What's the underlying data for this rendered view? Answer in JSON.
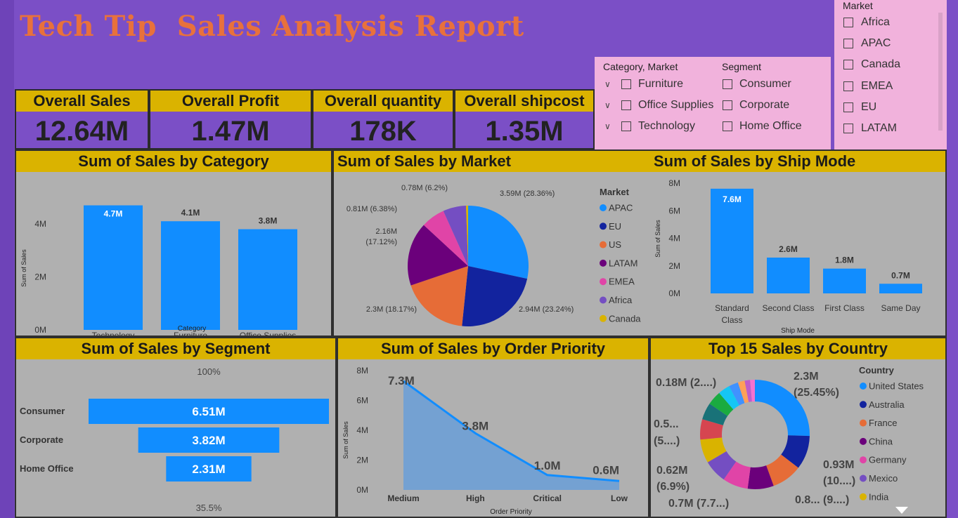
{
  "title": "Tech Tip  Sales Analysis Report",
  "kpis": [
    {
      "label": "Overall Sales",
      "value": "12.64M"
    },
    {
      "label": "Overall Profit",
      "value": "1.47M"
    },
    {
      "label": "Overall quantity",
      "value": "178K"
    },
    {
      "label": "Overall shipcost",
      "value": "1.35M"
    }
  ],
  "slicers": {
    "category_market_label": "Category, Market",
    "categories": [
      "Furniture",
      "Office Supplies",
      "Technology"
    ],
    "segment_label": "Segment",
    "segments": [
      "Consumer",
      "Corporate",
      "Home Office"
    ],
    "market_label": "Market",
    "markets": [
      "Africa",
      "APAC",
      "Canada",
      "EMEA",
      "EU",
      "LATAM"
    ]
  },
  "colors": {
    "accent": "#dab300",
    "bar": "#118dff",
    "panel": "#b0b0b0",
    "page": "#7b4fc6",
    "title": "#e8713c"
  },
  "chart_data": [
    {
      "title": "Sum of Sales by Category",
      "type": "bar",
      "categories": [
        "Technology",
        "Furniture",
        "Office Supplies"
      ],
      "values": [
        4.7,
        4.1,
        3.8
      ],
      "value_labels": [
        "4.7M",
        "4.1M",
        "3.8M"
      ],
      "xlabel": "Category",
      "ylabel": "Sum of Sales",
      "ticks": [
        "0M",
        "2M",
        "4M"
      ],
      "ylim": [
        0,
        4.9
      ]
    },
    {
      "title": "Sum of Sales by Market",
      "type": "pie",
      "legend_title": "Market",
      "series": [
        {
          "name": "APAC",
          "value": 3.59,
          "label": "3.59M (28.36%)",
          "color": "#118dff"
        },
        {
          "name": "EU",
          "value": 2.94,
          "label": "2.94M (23.24%)",
          "color": "#12239e"
        },
        {
          "name": "US",
          "value": 2.3,
          "label": "2.3M (18.17%)",
          "color": "#e66c37"
        },
        {
          "name": "LATAM",
          "value": 2.16,
          "label": "2.16M (17.12%)",
          "color": "#6b007b"
        },
        {
          "name": "EMEA",
          "value": 0.81,
          "label": "0.81M (6.38%)",
          "color": "#e044a7"
        },
        {
          "name": "Africa",
          "value": 0.78,
          "label": "0.78M (6.2%)",
          "color": "#744ec2"
        },
        {
          "name": "Canada",
          "value": 0.07,
          "label": "",
          "color": "#d9b300"
        }
      ]
    },
    {
      "title": "Sum of Sales by Ship Mode",
      "type": "bar",
      "categories": [
        "Standard Class",
        "Second Class",
        "First Class",
        "Same Day"
      ],
      "values": [
        7.6,
        2.6,
        1.8,
        0.7
      ],
      "value_labels": [
        "7.6M",
        "2.6M",
        "1.8M",
        "0.7M"
      ],
      "xlabel": "Ship Mode",
      "ylabel": "Sum of Sales",
      "ticks": [
        "0M",
        "2M",
        "4M",
        "6M",
        "8M"
      ],
      "ylim": [
        0,
        8
      ]
    },
    {
      "title": "Sum of Sales by Segment",
      "type": "bar",
      "orientation": "funnel",
      "categories": [
        "Consumer",
        "Corporate",
        "Home Office"
      ],
      "values": [
        6.51,
        3.82,
        2.31
      ],
      "value_labels": [
        "6.51M",
        "3.82M",
        "2.31M"
      ],
      "top_label": "100%",
      "bottom_label": "35.5%"
    },
    {
      "title": "Sum of Sales by Order Priority",
      "type": "area",
      "categories": [
        "Medium",
        "High",
        "Critical",
        "Low"
      ],
      "values": [
        7.3,
        3.8,
        1.0,
        0.6
      ],
      "value_labels": [
        "7.3M",
        "3.8M",
        "1.0M",
        "0.6M"
      ],
      "xlabel": "Order Priority",
      "ylabel": "Sum of Sales",
      "ticks": [
        "0M",
        "2M",
        "4M",
        "6M",
        "8M"
      ],
      "ylim": [
        0,
        8
      ]
    },
    {
      "title": "Top 15 Sales by Country",
      "type": "pie",
      "style": "donut",
      "legend_title": "Country",
      "legend": [
        "United States",
        "Australia",
        "France",
        "China",
        "Germany",
        "Mexico",
        "India"
      ],
      "values": [
        25.45,
        10.0,
        9.0,
        7.7,
        7.5,
        6.9,
        7.0,
        6.0,
        5.0,
        4.2,
        3.5,
        2.8,
        2.0,
        1.6,
        1.4
      ],
      "colors": [
        "#118dff",
        "#12239e",
        "#e66c37",
        "#6b007b",
        "#e044a7",
        "#744ec2",
        "#d9b300",
        "#d64550",
        "#197278",
        "#1aab40",
        "#15c6f4",
        "#4092ff",
        "#ffa058",
        "#be5dc9",
        "#f472d0"
      ],
      "labels": [
        "2.3M (25.45%)",
        "0.93M (10....)",
        "0.8... (9....)",
        "0.7M (7.7...)",
        "0.62M (6.9%)",
        "0.5... (5....)",
        "0.18M (2....)"
      ]
    }
  ]
}
